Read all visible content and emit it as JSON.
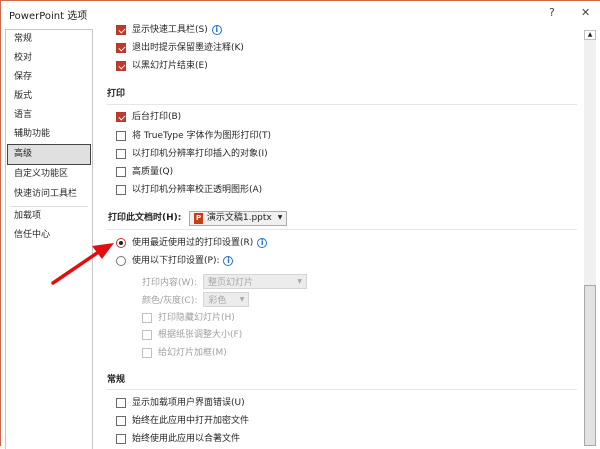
{
  "window": {
    "title": "PowerPoint 选项",
    "help": "?",
    "close": "✕"
  },
  "sidebar": {
    "items": [
      "常规",
      "校对",
      "保存",
      "版式",
      "语言",
      "辅助功能",
      "高级",
      "自定义功能区",
      "快速访问工具栏",
      "加载项",
      "信任中心"
    ],
    "selected": "高级"
  },
  "top_options": [
    {
      "label": "显示快速工具栏(S)",
      "checked": true,
      "info": true
    },
    {
      "label": "退出时提示保留墨迹注释(K)",
      "checked": true
    },
    {
      "label": "以黑幻灯片结束(E)",
      "checked": true
    }
  ],
  "print": {
    "heading": "打印",
    "options": [
      {
        "label": "后台打印(B)",
        "checked": true
      },
      {
        "label": "将 TrueType 字体作为图形打印(T)",
        "checked": false
      },
      {
        "label": "以打印机分辨率打印插入的对象(I)",
        "checked": false
      },
      {
        "label": "高质量(Q)",
        "checked": false
      },
      {
        "label": "以打印机分辨率校正透明图形(A)",
        "checked": false
      }
    ]
  },
  "print_doc": {
    "label": "打印此文档时(H):",
    "file": "演示文稿1.pptx",
    "file_icon": "P",
    "radio1": "使用最近使用过的打印设置(R)",
    "radio2": "使用以下打印设置(P):",
    "content_label": "打印内容(W):",
    "content_value": "整页幻灯片",
    "color_label": "颜色/灰度(C):",
    "color_value": "彩色",
    "sub_checks": [
      "打印隐藏幻灯片(H)",
      "根据纸张调整大小(F)",
      "给幻灯片加框(M)"
    ]
  },
  "general": {
    "heading": "常规",
    "options": [
      "显示加载项用户界面错误(U)",
      "始终在此应用中打开加密文件",
      "始终使用此应用以合著文件"
    ]
  },
  "colors": {
    "accent": "#c0392b",
    "arrow": "#e01010",
    "info": "#1e74c8"
  }
}
